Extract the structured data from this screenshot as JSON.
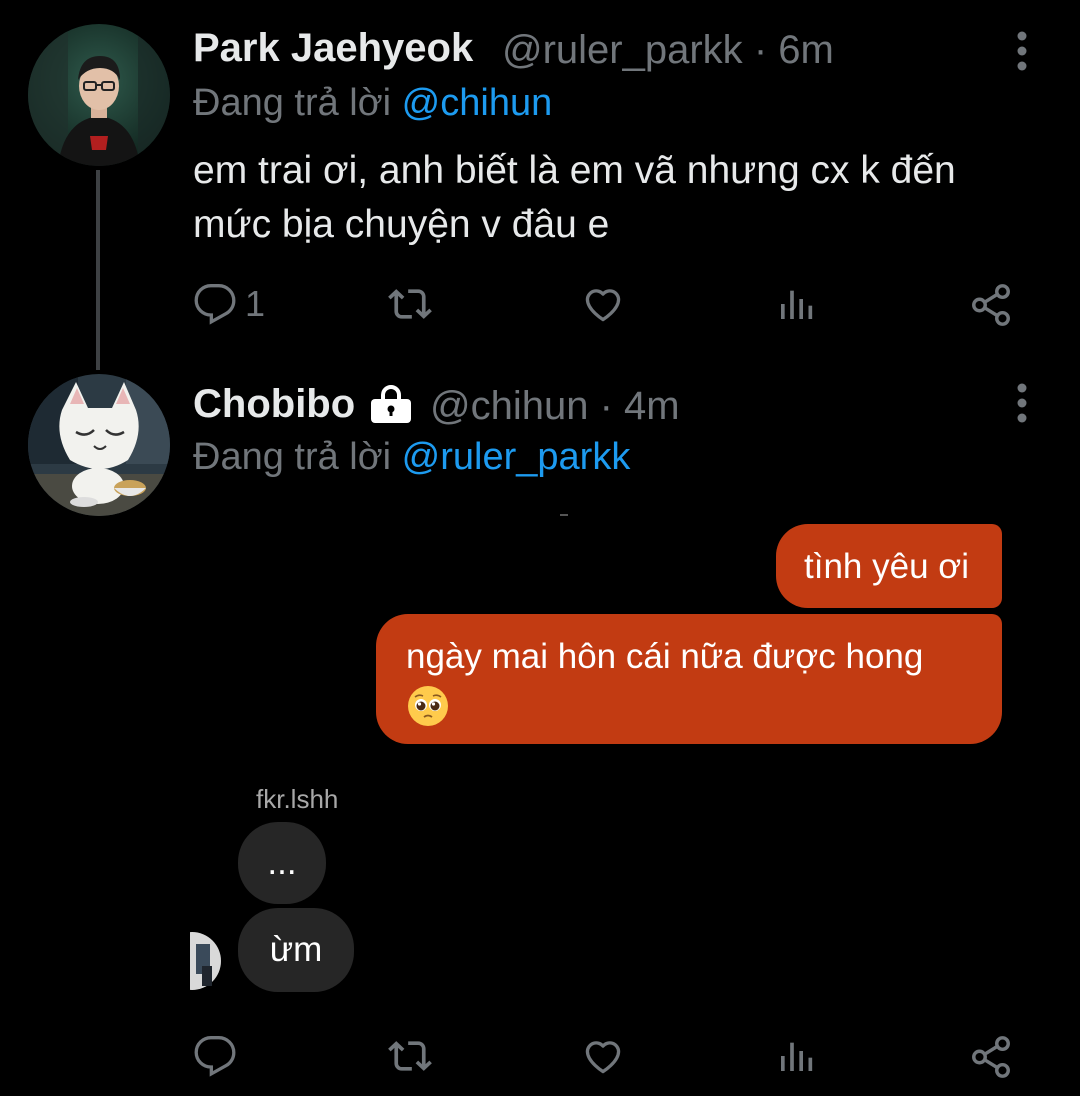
{
  "tweets": [
    {
      "display_name": "Park Jaehyeok",
      "handle": "@ruler_parkk",
      "time": "· 6m",
      "reply_prefix": "Đang trả lời",
      "reply_to": "@chihun",
      "text": "em trai ơi, anh biết là em vã nhưng cx k đến mức bịa chuyện v đâu e",
      "reply_count": "1"
    },
    {
      "display_name": "Chobibo",
      "handle": "@chihun",
      "time": "· 4m",
      "reply_prefix": "Đang trả lời",
      "reply_to": "@ruler_parkk",
      "locked": true
    }
  ],
  "chat": {
    "outgoing": [
      "tình yêu ơi",
      "ngày mai hôn cái nữa được hong"
    ],
    "sender": "fkr.lshh",
    "incoming": [
      "...",
      "ừm"
    ]
  },
  "icons": {
    "reply": "reply-icon",
    "retweet": "retweet-icon",
    "like": "heart-icon",
    "views": "views-icon",
    "share": "share-icon",
    "more": "more-vertical-icon",
    "lock": "lock-icon",
    "emoji": "pleading-face-emoji"
  },
  "colors": {
    "background": "#000000",
    "mention": "#1d9bf0",
    "muted": "#71767b",
    "outgoing_bubble": "#c23b12",
    "incoming_bubble": "#262626"
  }
}
